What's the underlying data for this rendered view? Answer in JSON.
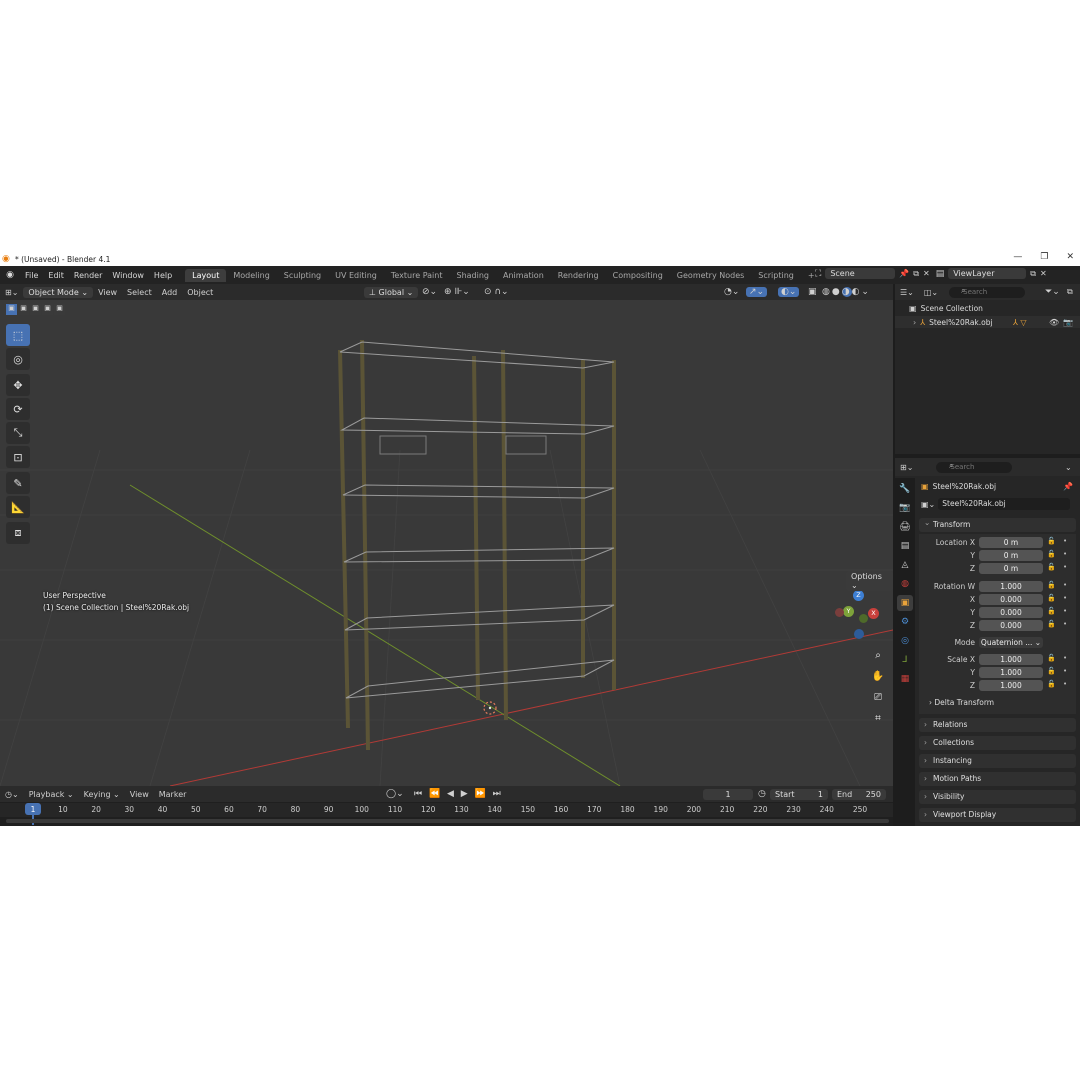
{
  "window": {
    "title": "* (Unsaved) - Blender 4.1",
    "minimize": "—",
    "maximize": "❐",
    "close": "✕"
  },
  "menu": [
    "File",
    "Edit",
    "Render",
    "Window",
    "Help"
  ],
  "workspaces": [
    "Layout",
    "Modeling",
    "Sculpting",
    "UV Editing",
    "Texture Paint",
    "Shading",
    "Animation",
    "Rendering",
    "Compositing",
    "Geometry Nodes",
    "Scripting"
  ],
  "scene": {
    "name": "Scene",
    "view_layer": "ViewLayer"
  },
  "viewport_header": {
    "mode": "Object Mode",
    "menus": [
      "View",
      "Select",
      "Add",
      "Object"
    ],
    "orientation": "Global",
    "options": "Options"
  },
  "viewport": {
    "perspective": "User Perspective",
    "collection_info": "(1) Scene Collection | Steel%20Rak.obj",
    "axis_x": "X",
    "axis_y": "Y",
    "axis_z": "Z"
  },
  "timeline": {
    "menus": [
      "Playback",
      "Keying",
      "View",
      "Marker"
    ],
    "current_frame": "1",
    "start_label": "Start",
    "start": "1",
    "end_label": "End",
    "end": "250",
    "ticks": [
      "1",
      "10",
      "20",
      "30",
      "40",
      "50",
      "60",
      "70",
      "80",
      "90",
      "100",
      "110",
      "120",
      "130",
      "140",
      "150",
      "160",
      "170",
      "180",
      "190",
      "200",
      "210",
      "220",
      "230",
      "240",
      "250"
    ]
  },
  "outliner": {
    "search_placeholder": "Search",
    "root": "Scene Collection",
    "object": "Steel%20Rak.obj"
  },
  "properties": {
    "search_placeholder": "Search",
    "object_title": "Steel%20Rak.obj",
    "object_name": "Steel%20Rak.obj",
    "transform_label": "Transform",
    "location_label": "Location X",
    "y_label": "Y",
    "z_label": "Z",
    "x_label": "X",
    "w_label": "Rotation W",
    "location": [
      "0 m",
      "0 m",
      "0 m"
    ],
    "rotation": [
      "1.000",
      "0.000",
      "0.000",
      "0.000"
    ],
    "mode_label": "Mode",
    "mode_value": "Quaternion ...",
    "scale_label": "Scale X",
    "scale": [
      "1.000",
      "1.000",
      "1.000"
    ],
    "delta": "Delta Transform",
    "panels": [
      "Relations",
      "Collections",
      "Instancing",
      "Motion Paths",
      "Visibility",
      "Viewport Display"
    ]
  },
  "colors": {
    "accent": "#4772b3",
    "x_axis": "#c8403c",
    "y_axis": "#7ea33a",
    "z_axis": "#3d7fd4",
    "object_orange": "#e8a23a"
  }
}
